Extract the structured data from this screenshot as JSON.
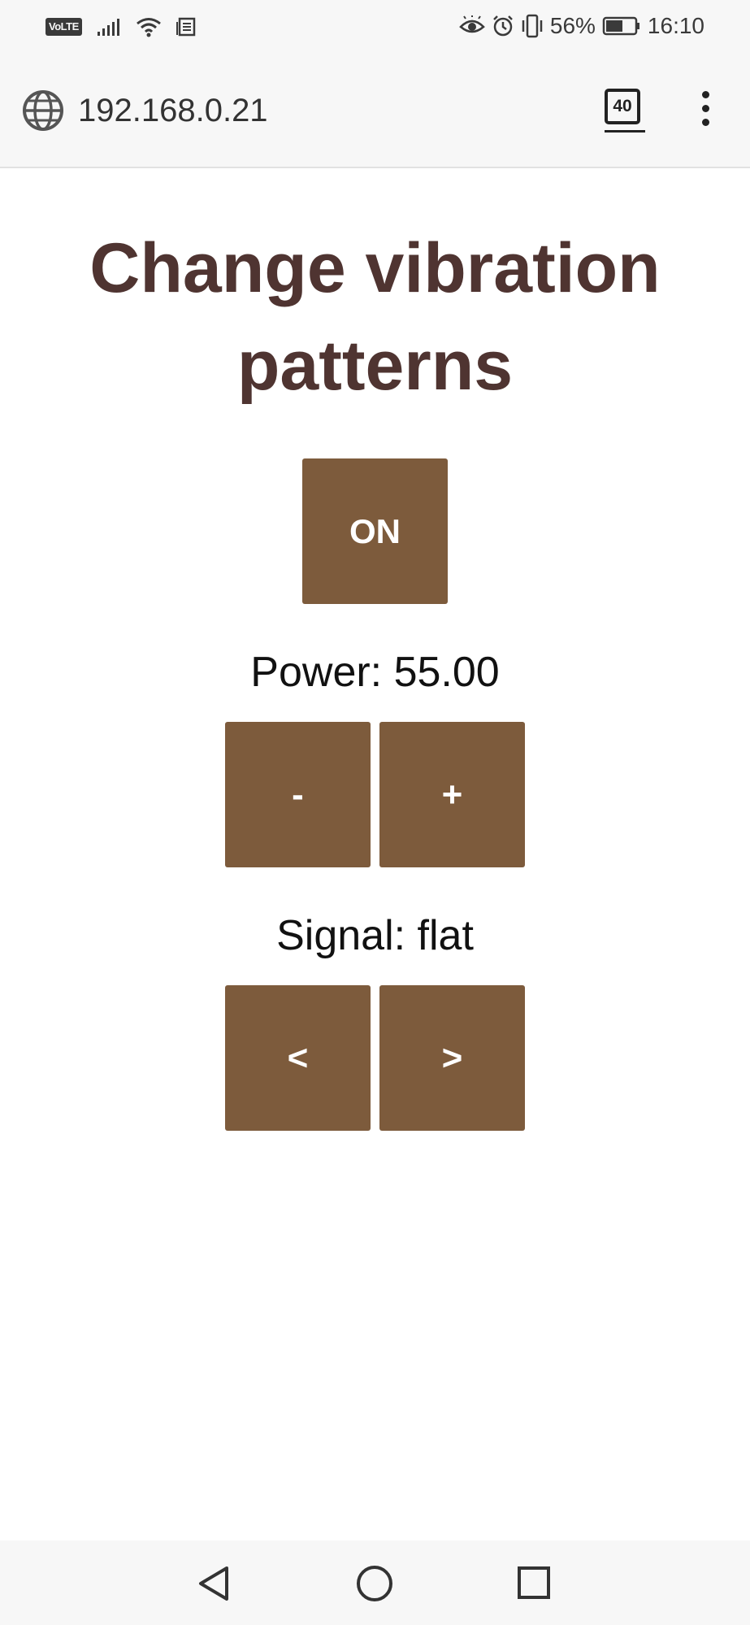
{
  "status_bar": {
    "volte": "VoLTE",
    "battery_percent": "56%",
    "time": "16:10",
    "icons": [
      "signal-icon",
      "wifi-icon",
      "notification-icon",
      "eye-comfort-icon",
      "alarm-icon",
      "vibrate-icon",
      "battery-icon"
    ]
  },
  "browser": {
    "url": "192.168.0.21",
    "tab_count": "40"
  },
  "page": {
    "title": "Change vibration patterns",
    "on_button": "ON",
    "power_label": "Power: 55.00",
    "minus_button": "-",
    "plus_button": "+",
    "signal_label": "Signal: flat",
    "prev_button": "<",
    "next_button": ">"
  },
  "colors": {
    "title": "#4f3431",
    "button": "#7d5b3c",
    "button_text": "#ffffff"
  }
}
